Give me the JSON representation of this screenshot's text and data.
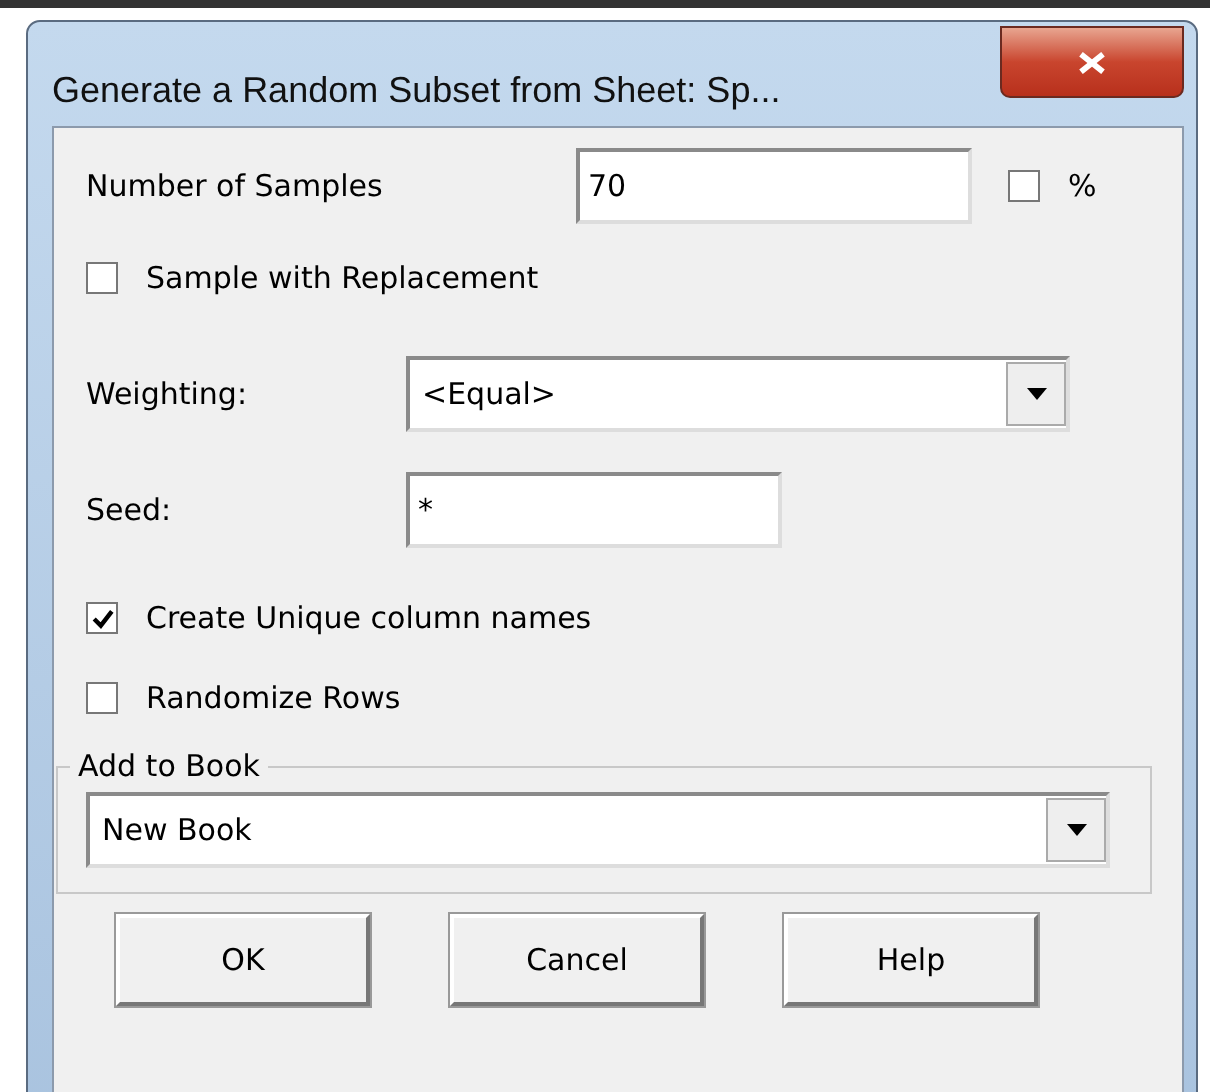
{
  "window": {
    "title": "Generate a Random Subset from Sheet: Sp..."
  },
  "samples": {
    "label": "Number of Samples",
    "value": "70",
    "percent": {
      "label": "%",
      "checked": false
    }
  },
  "replacement": {
    "label": "Sample with Replacement",
    "checked": false
  },
  "weighting": {
    "label": "Weighting:",
    "value": "<Equal>"
  },
  "seed": {
    "label": "Seed:",
    "value": "*"
  },
  "options": [
    {
      "label": "Create Unique column names",
      "checked": true
    },
    {
      "label": "Randomize Rows",
      "checked": false
    }
  ],
  "add_to_book": {
    "legend": "Add to Book",
    "value": "New Book"
  },
  "buttons": [
    "OK",
    "Cancel",
    "Help"
  ]
}
